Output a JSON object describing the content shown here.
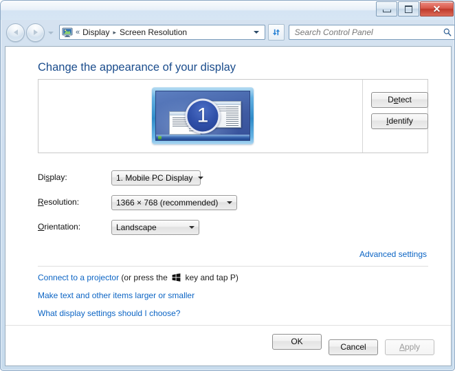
{
  "window": {
    "caption_buttons": {
      "minimize": "minimize-label",
      "maximize": "maximize-label",
      "close": "✕"
    }
  },
  "navbar": {
    "back_tooltip": "Back",
    "forward_tooltip": "Forward",
    "recent_pages_tooltip": "Recent pages",
    "breadcrumb": {
      "chevrons": "«",
      "items": [
        "Display",
        "Screen Resolution"
      ],
      "separator": "▸"
    },
    "refresh_tooltip": "Refresh",
    "search": {
      "placeholder": "Search Control Panel",
      "value": ""
    }
  },
  "main": {
    "page_title": "Change the appearance of your display",
    "preview": {
      "monitor_number": "1"
    },
    "detect_button": {
      "pre": "D",
      "accel": "e",
      "post": "tect"
    },
    "identify_button": {
      "pre": "",
      "accel": "I",
      "post": "dentify"
    },
    "fields": [
      {
        "label_pre": "Di",
        "label_accel": "s",
        "label_post": "play:",
        "value": "1. Mobile PC Display",
        "combo_width": 130
      },
      {
        "label_pre": "",
        "label_accel": "R",
        "label_post": "esolution:",
        "value": "1366 × 768 (recommended)",
        "combo_width": 183
      },
      {
        "label_pre": "",
        "label_accel": "O",
        "label_post": "rientation:",
        "value": "Landscape",
        "combo_width": 128
      }
    ],
    "advanced_settings_link": "Advanced settings",
    "links": [
      {
        "link_text": "Connect to a projector",
        "tail_before_key": " (or press the ",
        "tail_after_key": " key and tap P)"
      },
      {
        "link_text": "Make text and other items larger or smaller",
        "tail_before_key": "",
        "tail_after_key": ""
      },
      {
        "link_text": "What display settings should I choose?",
        "tail_before_key": "",
        "tail_after_key": ""
      }
    ],
    "footer": {
      "ok": {
        "pre": "OK",
        "accel": "",
        "post": ""
      },
      "cancel": {
        "pre": "Cancel",
        "accel": "",
        "post": ""
      },
      "apply": {
        "pre": "",
        "accel": "A",
        "post": "pply"
      },
      "apply_enabled": false
    }
  },
  "colors": {
    "link_blue": "#0b64c4",
    "title_blue": "#1a4c8c",
    "accent": "#2f4fa8"
  }
}
